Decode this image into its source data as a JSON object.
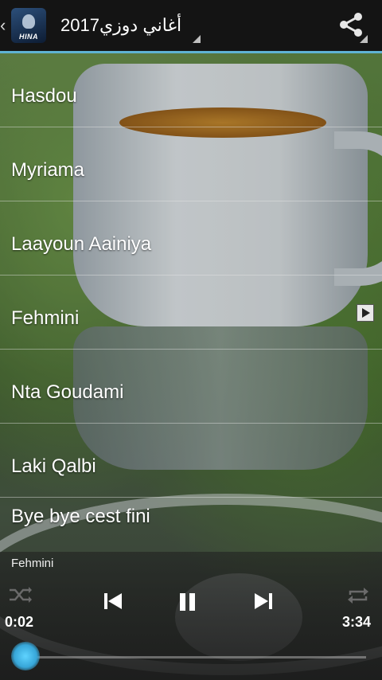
{
  "app": {
    "title": "أغاني دوزي2017",
    "icon_label": "HINA"
  },
  "songs": [
    {
      "title": "Hasdou"
    },
    {
      "title": "Myriama"
    },
    {
      "title": "Laayoun Aainiya"
    },
    {
      "title": "Fehmini"
    },
    {
      "title": "Nta Goudami"
    },
    {
      "title": "Laki Qalbi"
    },
    {
      "title": "Bye bye cest fini"
    }
  ],
  "player": {
    "now_playing": "Fehmini",
    "current_time": "0:02",
    "total_time": "3:34",
    "progress": 0.01
  },
  "colors": {
    "accent": "#5fb3d4",
    "topbar": "#141414"
  },
  "icons": [
    "back-chevron-icon",
    "app-icon",
    "share-icon",
    "now-playing-icon",
    "shuffle-icon",
    "previous-icon",
    "pause-icon",
    "next-icon",
    "repeat-icon"
  ]
}
